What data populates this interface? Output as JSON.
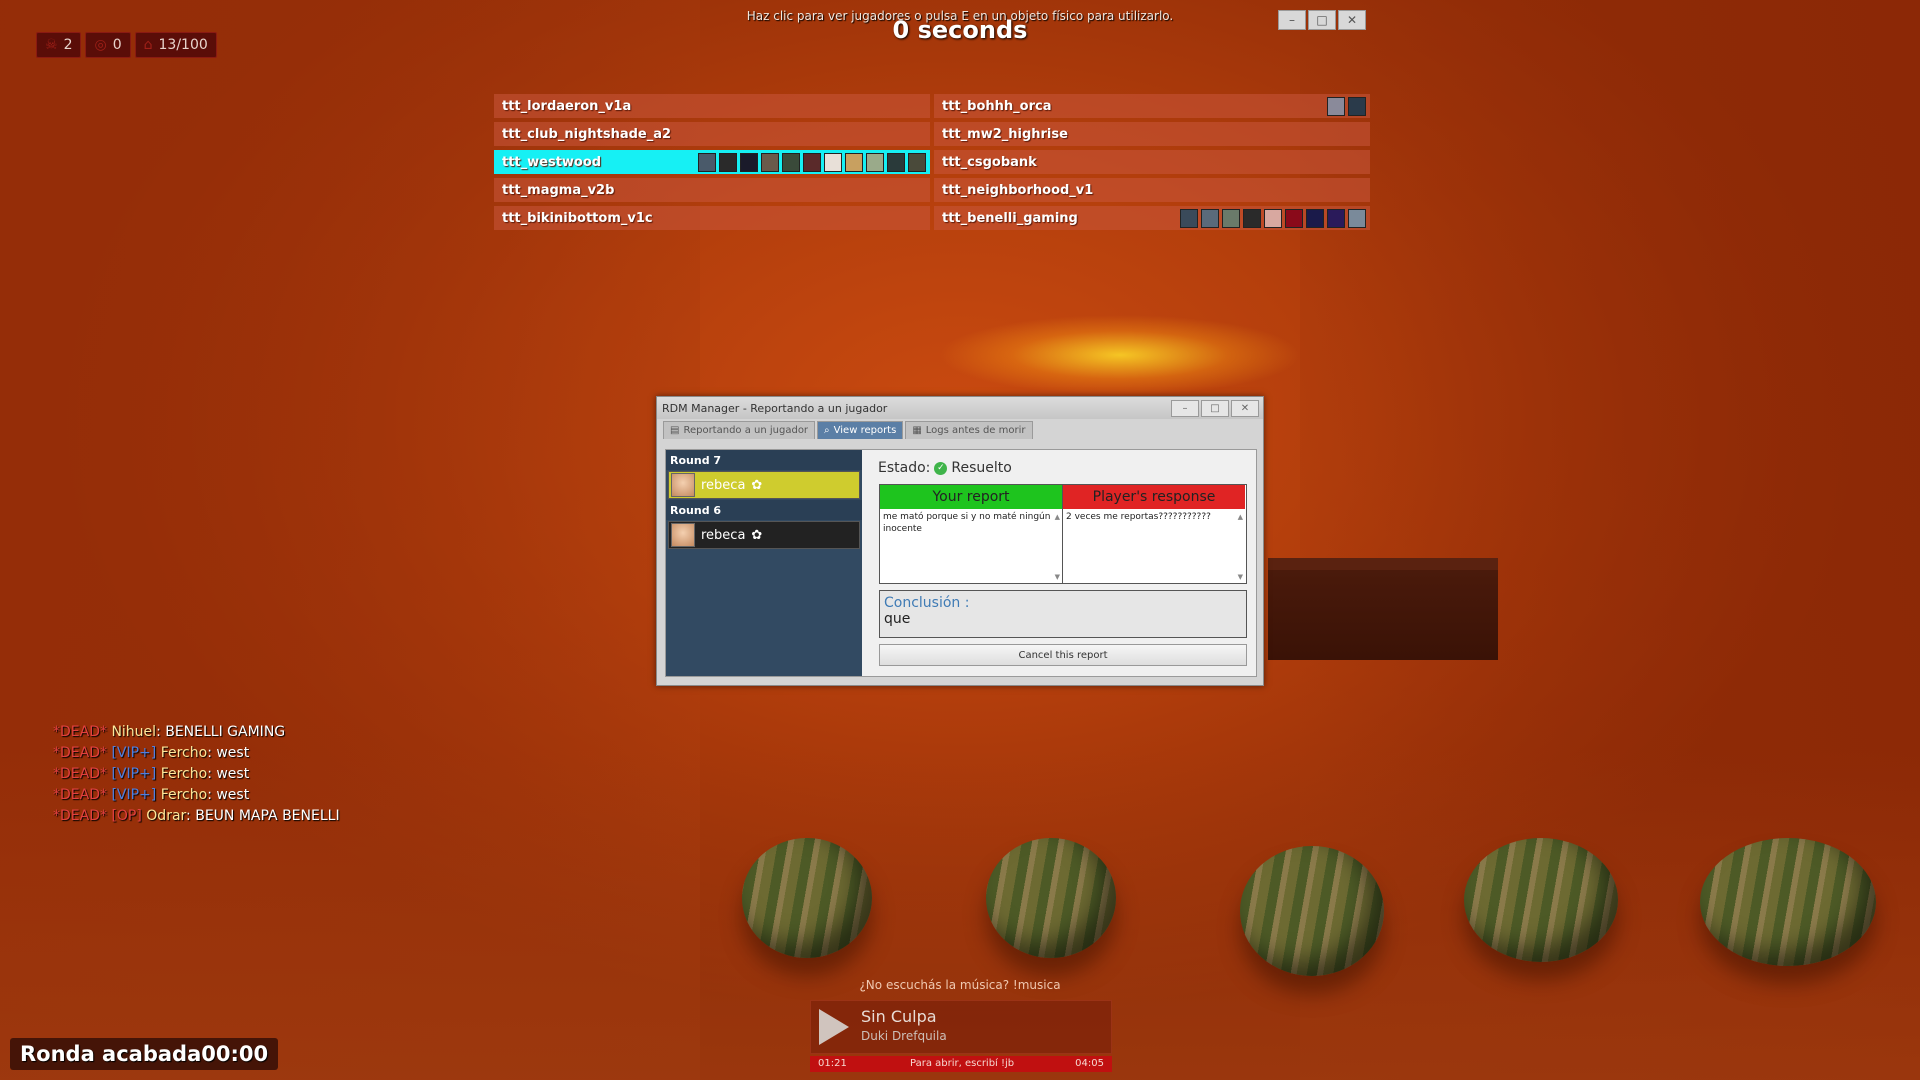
{
  "hud": {
    "kills": "2",
    "deaths": "0",
    "players": "13/100",
    "hint": "Haz clic para ver jugadores o pulsa E en un objeto físico para utilizarlo.",
    "timer": "0 seconds"
  },
  "maps": [
    {
      "name": "ttt_lordaeron_v1a",
      "votes": 0
    },
    {
      "name": "ttt_bohhh_orca",
      "votes": 2
    },
    {
      "name": "ttt_club_nightshade_a2",
      "votes": 0
    },
    {
      "name": "ttt_mw2_highrise",
      "votes": 0
    },
    {
      "name": "ttt_westwood",
      "votes": 11,
      "selected": true
    },
    {
      "name": "ttt_csgobank",
      "votes": 0
    },
    {
      "name": "ttt_magma_v2b",
      "votes": 0
    },
    {
      "name": "ttt_neighborhood_v1",
      "votes": 0
    },
    {
      "name": "ttt_bikinibottom_v1c",
      "votes": 0
    },
    {
      "name": "ttt_benelli_gaming",
      "votes": 9
    }
  ],
  "rdm": {
    "title": "RDM Manager - Reportando a un jugador",
    "tabs": [
      "Reportando a un jugador",
      "View reports",
      "Logs antes de morir"
    ],
    "active_tab": "View reports",
    "rounds": [
      {
        "label": "Round 7",
        "player": "rebeca",
        "selected": true
      },
      {
        "label": "Round 6",
        "player": "rebeca",
        "selected": false
      }
    ],
    "estado_label": "Estado:",
    "estado_value": "Resuelto",
    "your_report_header": "Your report",
    "your_report_text": "me mató porque si y no maté ningún inocente",
    "response_header": "Player's response",
    "response_text": "2 veces me reportas???????????",
    "conclusion_label": "Conclusión :",
    "conclusion_value": "que",
    "cancel_label": "Cancel this report"
  },
  "chat": [
    {
      "dead": "*DEAD*",
      "tag": "",
      "name": "Nihuel",
      "msg": "BENELLI GAMING"
    },
    {
      "dead": "*DEAD*",
      "tag": "[VIP+]",
      "name": "Fercho",
      "msg": "west"
    },
    {
      "dead": "*DEAD*",
      "tag": "[VIP+]",
      "name": "Fercho",
      "msg": "west"
    },
    {
      "dead": "*DEAD*",
      "tag": "[VIP+]",
      "name": "Fercho",
      "msg": "west"
    },
    {
      "dead": "*DEAD*",
      "tag": "[OP]",
      "name": "Odrar",
      "msg": "BEUN MAPA BENELLI"
    }
  ],
  "round_status": "Ronda acabada",
  "round_time": "00:00",
  "music": {
    "hint": "¿No escuchás la música? !musica",
    "song": "Sin Culpa",
    "artist": "Duki Drefquila",
    "elapsed": "01:21",
    "open_hint": "Para abrir, escribí !jb",
    "duration": "04:05"
  }
}
